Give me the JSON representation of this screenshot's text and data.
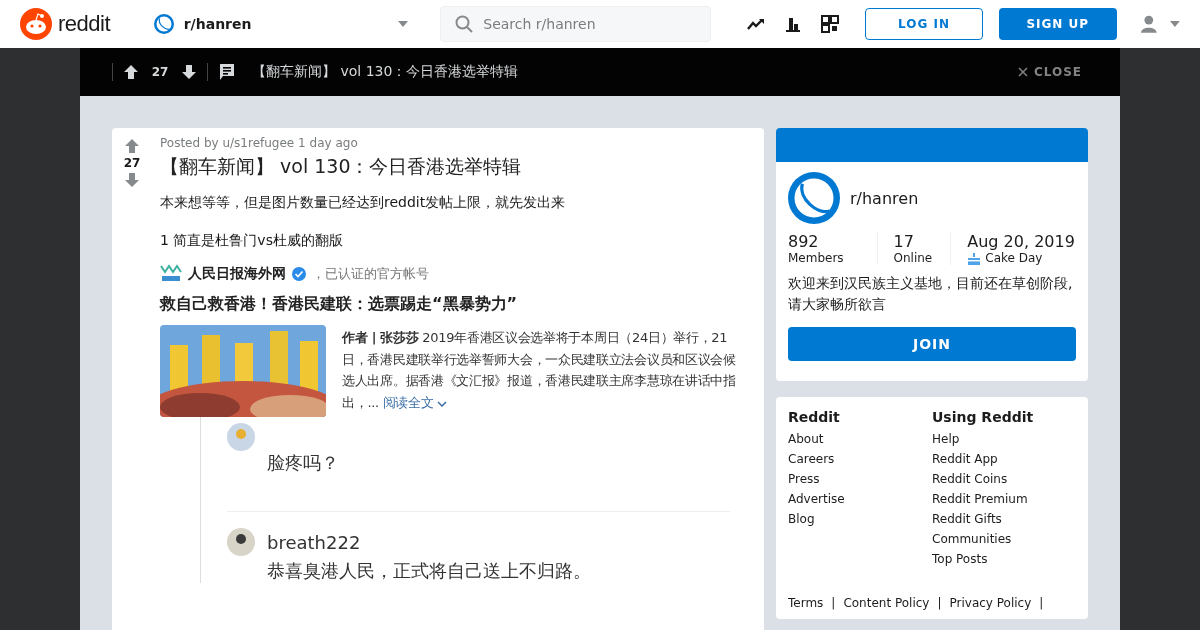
{
  "header": {
    "logo_text": "reddit",
    "community": "r/hanren",
    "search_placeholder": "Search r/hanren",
    "login": "LOG IN",
    "signup": "SIGN UP"
  },
  "post_bar": {
    "votes": "27",
    "title": "【翻车新闻】 vol 130：今日香港选举特辑",
    "close": "CLOSE"
  },
  "post": {
    "votes": "27",
    "meta": "Posted by u/s1refugee 1 day ago",
    "title": "【翻车新闻】 vol 130：今日香港选举特辑",
    "paragraphs": [
      "本来想等等，但是图片数量已经达到reddit发帖上限，就先发出来",
      "1 简直是杜鲁门vs杜威的翻版"
    ],
    "screenshot": {
      "source": "人民日报海外网",
      "verified_note": "，已认证的官方帐号",
      "headline": "救自己救香港！香港民建联：选票踢走“黑暴势力”",
      "body": "**作者 | 张莎莎** 2019年香港区议会选举将于本周日（24日）举行，21日，香港民建联举行选举誓师大会，一众民建联立法会议员和区议会候选人出席。据香港《文汇报》报道，香港民建联主席李慧琼在讲话中指出，...",
      "read_more": "阅读全文",
      "comments": [
        {
          "text": "脸疼吗？"
        },
        {
          "user": "breath222",
          "text": "恭喜臭港人民，正式将自己送上不归路。"
        }
      ]
    }
  },
  "sidebar": {
    "community": "r/hanren",
    "stats": [
      {
        "value": "892",
        "label": "Members"
      },
      {
        "value": "17",
        "label": "Online"
      },
      {
        "value": "Aug 20, 2019",
        "label": "Cake Day",
        "kind": "cake"
      }
    ],
    "description": "欢迎来到汉民族主义基地，目前还在草创阶段,请大家畅所欲言",
    "join": "JOIN"
  },
  "footer": {
    "columns": [
      {
        "heading": "Reddit",
        "links": [
          "About",
          "Careers",
          "Press",
          "Advertise",
          "Blog"
        ]
      },
      {
        "heading": "Using Reddit",
        "links": [
          "Help",
          "Reddit App",
          "Reddit Coins",
          "Reddit Premium",
          "Reddit Gifts",
          "Communities",
          "Top Posts"
        ]
      }
    ],
    "bottom_links": [
      "Terms",
      "Content Policy",
      "Privacy Policy"
    ],
    "separator": "|"
  }
}
